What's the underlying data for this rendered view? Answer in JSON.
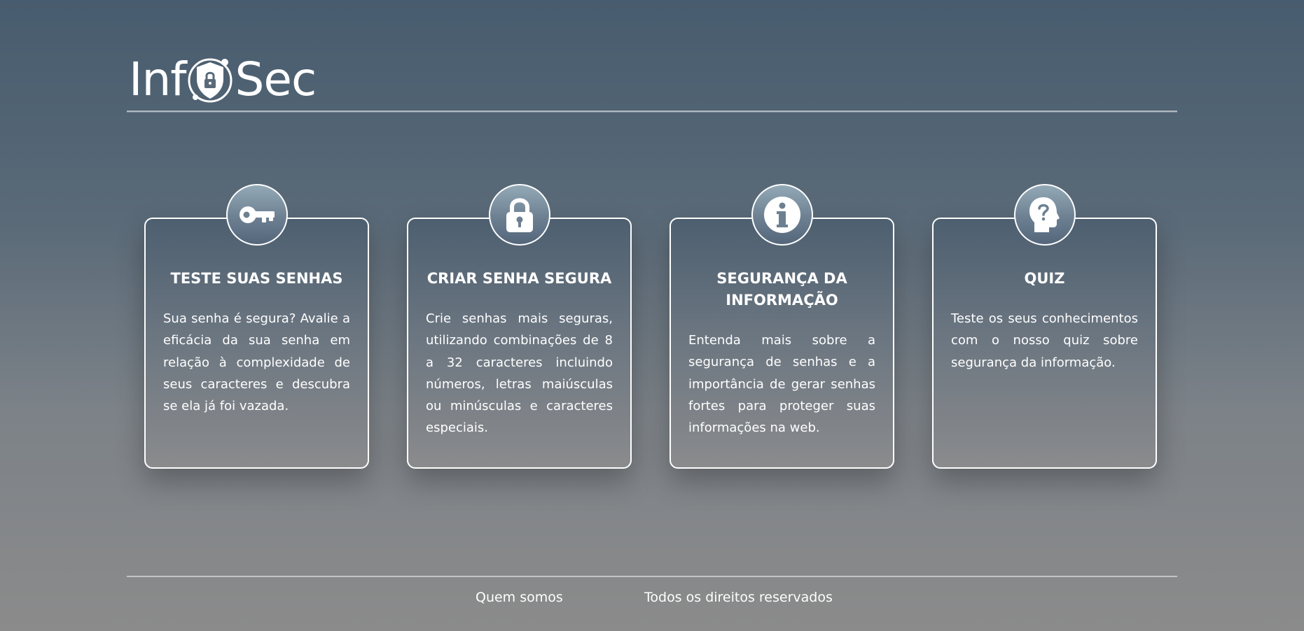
{
  "brand": {
    "logo_left": "Inf",
    "logo_right": "Sec"
  },
  "cards": [
    {
      "icon": "key-icon",
      "title": "TESTE SUAS SENHAS",
      "description": "Sua senha é segura? Avalie a eficácia da sua senha em relação à complexidade de seus caracteres e descubra se ela já foi vazada."
    },
    {
      "icon": "padlock-icon",
      "title": "CRIAR SENHA SEGURA",
      "description": "Crie senhas mais seguras, utilizando combinações de 8 a 32 caracteres incluindo números, letras maiúsculas ou minúsculas e caracteres especiais."
    },
    {
      "icon": "info-icon",
      "title": "SEGURANÇA DA INFORMAÇÃO",
      "description": "Entenda mais sobre a segurança de senhas e a importância de gerar senhas fortes para proteger suas informações na web."
    },
    {
      "icon": "head-question-icon",
      "title": "QUIZ",
      "description": "Teste os seus conhecimentos com o nosso quiz sobre segurança da informação."
    }
  ],
  "footer": {
    "about_label": "Quem somos",
    "rights_label": "Todos os direitos reservados"
  },
  "colors": {
    "background_top": "#475c6e",
    "background_bottom": "#8b8b8b",
    "card_border": "#ffffff",
    "icon_circle": "#6d8092",
    "text": "#ffffff"
  }
}
